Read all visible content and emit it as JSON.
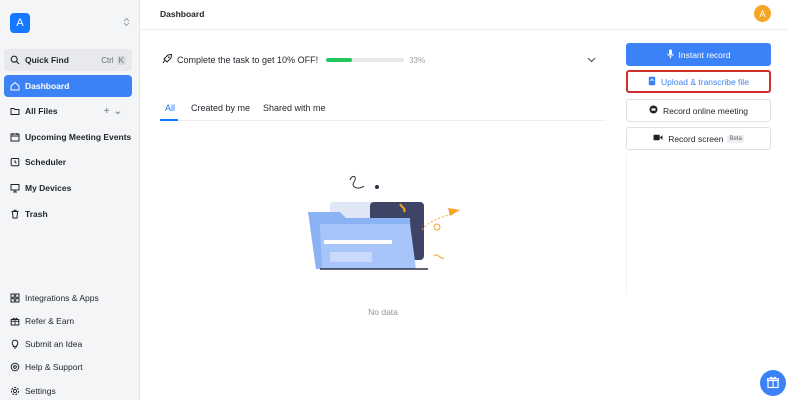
{
  "workspace": {
    "avatar_letter": "A",
    "switch_icon": "chevron-up-down-icon"
  },
  "sidebar": {
    "quick_find": {
      "label": "Quick Find",
      "shortcut_ctrl": "Ctrl",
      "shortcut_key": "K"
    },
    "items": [
      {
        "label": "Dashboard",
        "icon": "home-icon",
        "active": true
      },
      {
        "label": "All Files",
        "icon": "folder-icon",
        "add": "+",
        "expand": "⌄"
      },
      {
        "label": "Upcoming Meeting Events",
        "icon": "calendar-icon"
      },
      {
        "label": "Scheduler",
        "icon": "clock-icon"
      },
      {
        "label": "My Devices",
        "icon": "device-icon"
      },
      {
        "label": "Trash",
        "icon": "trash-icon"
      }
    ],
    "bottom_items": [
      {
        "label": "Integrations & Apps",
        "icon": "apps-icon"
      },
      {
        "label": "Refer & Earn",
        "icon": "gift-icon"
      },
      {
        "label": "Submit an Idea",
        "icon": "lightbulb-icon"
      },
      {
        "label": "Help & Support",
        "icon": "help-icon"
      },
      {
        "label": "Settings",
        "icon": "gear-icon"
      }
    ]
  },
  "header": {
    "title": "Dashboard",
    "user_avatar_letter": "A"
  },
  "promo": {
    "text": "Complete the task to get 10% OFF!",
    "progress_percent": 33,
    "progress_label": "33%"
  },
  "tabs": [
    {
      "label": "All",
      "active": true
    },
    {
      "label": "Created by me"
    },
    {
      "label": "Shared with me"
    }
  ],
  "empty_state": {
    "text": "No data"
  },
  "actions": {
    "instant_record": "Instant record",
    "upload": "Upload & transcribe file",
    "online_meeting": "Record online meeting",
    "record_screen": "Record screen",
    "beta": "Beta"
  },
  "colors": {
    "accent": "#3b82f6",
    "progress": "#22c55e",
    "highlight": "#d32f2f",
    "user_avatar": "#f5a524"
  }
}
